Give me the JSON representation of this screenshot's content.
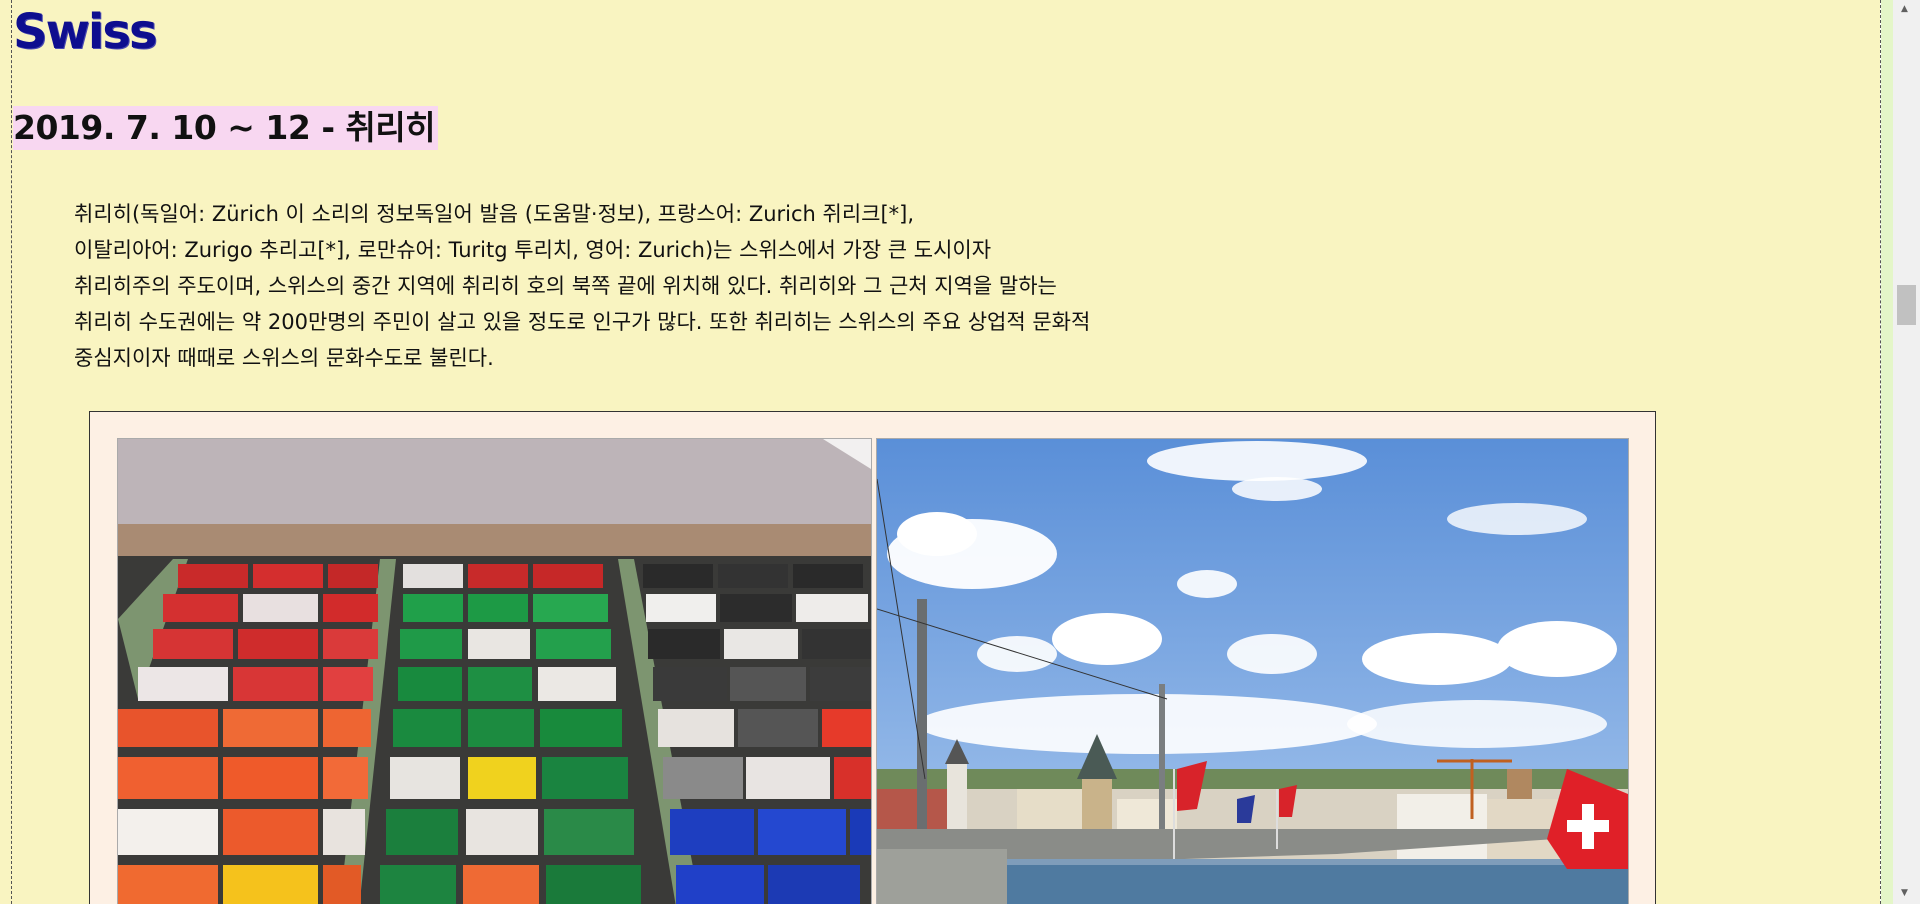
{
  "header": {
    "site_title": "Swiss",
    "section_title": "2019. 7. 10 ~ 12 - 취리히"
  },
  "article": {
    "lines": [
      "취리히(독일어: Zürich 이 소리의 정보독일어 발음 (도움말·정보), 프랑스어: Zurich 쥐리크[*],",
      "이탈리아어: Zurigo 추리고[*], 로만슈어: Turitg 투리치, 영어: Zurich)는 스위스에서 가장 큰 도시이자",
      "취리히주의 주도이며, 스위스의 중간 지역에 취리히 호의 북쪽 끝에 위치해 있다. 취리히와 그 근처 지역을 말하는",
      "취리히 수도권에는 약 200만명의 주민이 살고 있을 정도로 인구가 많다. 또한 취리히는 스위스의 주요 상업적 문화적",
      "중심지이자 때때로 스위스의 문화수도로 불린다."
    ]
  },
  "gallery": {
    "photos": [
      {
        "subject": "drawer of colorful tarpaulin wallets"
      },
      {
        "subject": "lake bridge with swiss flags under blue sky"
      }
    ]
  },
  "colors": {
    "page_background": "#f9f4c1",
    "title_color": "#0e0e8f",
    "section_highlight": "#f8d7f1",
    "gallery_background": "#fdf0e4"
  }
}
